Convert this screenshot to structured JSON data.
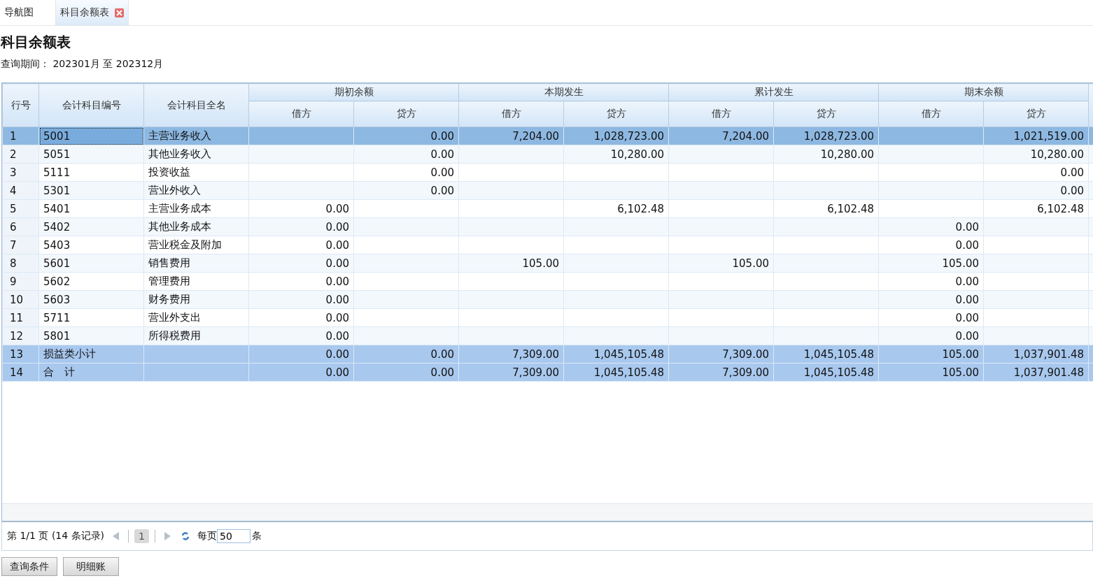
{
  "tabs": [
    {
      "label": "导航图",
      "selected": false,
      "closable": false
    },
    {
      "label": "科目余额表",
      "selected": true,
      "closable": true
    }
  ],
  "title": "科目余额表",
  "period": {
    "label": "查询期间：",
    "value": "202301月 至 202312月"
  },
  "table": {
    "row_header": "行号",
    "code_header": "会计科目编号",
    "name_header": "会计科目全名",
    "groups": [
      {
        "label": "期初余额",
        "columns": [
          "借方",
          "贷方"
        ]
      },
      {
        "label": "本期发生",
        "columns": [
          "借方",
          "贷方"
        ]
      },
      {
        "label": "累计发生",
        "columns": [
          "借方",
          "贷方"
        ]
      },
      {
        "label": "期末余额",
        "columns": [
          "借方",
          "贷方"
        ]
      }
    ],
    "rows": [
      {
        "no": "1",
        "code": "5001",
        "name": "主营业务收入",
        "kind": "detail",
        "selected": true,
        "cells": {
          "opening_credit": "0.00",
          "period_debit": "7,204.00",
          "period_credit": "1,028,723.00",
          "cumulative_debit": "7,204.00",
          "cumulative_credit": "1,028,723.00",
          "closing_credit": "1,021,519.00"
        }
      },
      {
        "no": "2",
        "code": "5051",
        "name": "其他业务收入",
        "kind": "detail",
        "selected": false,
        "cells": {
          "opening_credit": "0.00",
          "period_credit": "10,280.00",
          "cumulative_credit": "10,280.00",
          "closing_credit": "10,280.00"
        }
      },
      {
        "no": "3",
        "code": "5111",
        "name": "投资收益",
        "kind": "detail",
        "selected": false,
        "cells": {
          "opening_credit": "0.00",
          "closing_credit": "0.00"
        }
      },
      {
        "no": "4",
        "code": "5301",
        "name": "营业外收入",
        "kind": "detail",
        "selected": false,
        "cells": {
          "opening_credit": "0.00",
          "closing_credit": "0.00"
        }
      },
      {
        "no": "5",
        "code": "5401",
        "name": "主营业务成本",
        "kind": "detail",
        "selected": false,
        "cells": {
          "opening_debit": "0.00",
          "period_credit": "6,102.48",
          "cumulative_credit": "6,102.48",
          "closing_credit": "6,102.48"
        }
      },
      {
        "no": "6",
        "code": "5402",
        "name": "其他业务成本",
        "kind": "detail",
        "selected": false,
        "cells": {
          "opening_debit": "0.00",
          "closing_debit": "0.00"
        }
      },
      {
        "no": "7",
        "code": "5403",
        "name": "营业税金及附加",
        "kind": "detail",
        "selected": false,
        "cells": {
          "opening_debit": "0.00",
          "closing_debit": "0.00"
        }
      },
      {
        "no": "8",
        "code": "5601",
        "name": "销售费用",
        "kind": "detail",
        "selected": false,
        "cells": {
          "opening_debit": "0.00",
          "period_debit": "105.00",
          "cumulative_debit": "105.00",
          "closing_debit": "105.00"
        }
      },
      {
        "no": "9",
        "code": "5602",
        "name": "管理费用",
        "kind": "detail",
        "selected": false,
        "cells": {
          "opening_debit": "0.00",
          "closing_debit": "0.00"
        }
      },
      {
        "no": "10",
        "code": "5603",
        "name": "财务费用",
        "kind": "detail",
        "selected": false,
        "cells": {
          "opening_debit": "0.00",
          "closing_debit": "0.00"
        }
      },
      {
        "no": "11",
        "code": "5711",
        "name": "营业外支出",
        "kind": "detail",
        "selected": false,
        "cells": {
          "opening_debit": "0.00",
          "closing_debit": "0.00"
        }
      },
      {
        "no": "12",
        "code": "5801",
        "name": "所得税费用",
        "kind": "detail",
        "selected": false,
        "cells": {
          "opening_debit": "0.00",
          "closing_debit": "0.00"
        }
      },
      {
        "no": "13",
        "code": "损益类小计",
        "kind": "subtotal",
        "selected": false,
        "cells": {
          "opening_debit": "0.00",
          "opening_credit": "0.00",
          "period_debit": "7,309.00",
          "period_credit": "1,045,105.48",
          "cumulative_debit": "7,309.00",
          "cumulative_credit": "1,045,105.48",
          "closing_debit": "105.00",
          "closing_credit": "1,037,901.48"
        }
      },
      {
        "no": "14",
        "code": "合　计",
        "kind": "subtotal",
        "selected": false,
        "cells": {
          "opening_debit": "0.00",
          "opening_credit": "0.00",
          "period_debit": "7,309.00",
          "period_credit": "1,045,105.48",
          "cumulative_debit": "7,309.00",
          "cumulative_credit": "1,045,105.48",
          "closing_debit": "105.00",
          "closing_credit": "1,037,901.48"
        }
      }
    ]
  },
  "pager": {
    "info": "第 1/1 页 (14 条记录)",
    "page": "1",
    "per_page_label": "每页",
    "per_page": "50",
    "unit": "条"
  },
  "buttons": [
    "查询条件",
    "明细账"
  ]
}
